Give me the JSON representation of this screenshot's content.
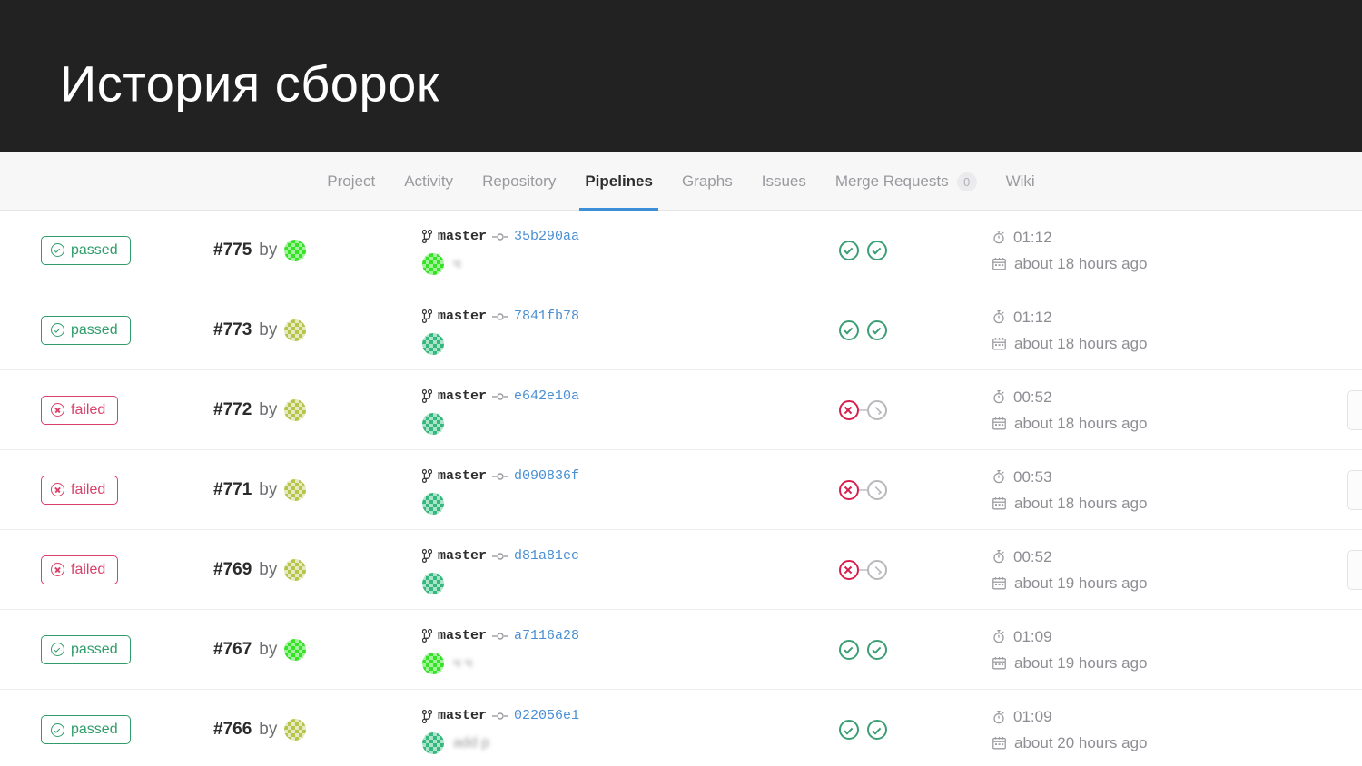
{
  "slide": {
    "title": "История сборок",
    "header_bg": "#222222"
  },
  "nav": {
    "items": [
      {
        "label": "Project",
        "active": false,
        "badge": null
      },
      {
        "label": "Activity",
        "active": false,
        "badge": null
      },
      {
        "label": "Repository",
        "active": false,
        "badge": null
      },
      {
        "label": "Pipelines",
        "active": true,
        "badge": null
      },
      {
        "label": "Graphs",
        "active": false,
        "badge": null
      },
      {
        "label": "Issues",
        "active": false,
        "badge": null
      },
      {
        "label": "Merge Requests",
        "active": false,
        "badge": "0"
      },
      {
        "label": "Wiki",
        "active": false,
        "badge": null
      }
    ],
    "active_underline_color": "#3d8ed8"
  },
  "colors": {
    "passed": "#2f9c6a",
    "failed": "#d9416b",
    "stage_ok": "#3c9e74",
    "stage_fail": "#d5204f",
    "stage_skip": "#b8b8bc",
    "sha_link": "#4a8fd4"
  },
  "table": {
    "by_label": "by",
    "rows": [
      {
        "status": "passed",
        "id": "#775",
        "author_avatar": "identicon-green",
        "branch": "master",
        "sha": "35b290aa",
        "commit_message": "ч",
        "commit_avatar": "identicon-green",
        "stages": [
          "ok",
          "ok"
        ],
        "duration": "01:12",
        "finished": "about 18 hours ago",
        "retry": false
      },
      {
        "status": "passed",
        "id": "#773",
        "author_avatar": "identicon-olive",
        "branch": "master",
        "sha": "7841fb78",
        "commit_message": "",
        "commit_avatar": "identicon-teal",
        "stages": [
          "ok",
          "ok"
        ],
        "duration": "01:12",
        "finished": "about 18 hours ago",
        "retry": false
      },
      {
        "status": "failed",
        "id": "#772",
        "author_avatar": "identicon-olive",
        "branch": "master",
        "sha": "e642e10a",
        "commit_message": "",
        "commit_avatar": "identicon-teal",
        "stages": [
          "fail",
          "skip"
        ],
        "duration": "00:52",
        "finished": "about 18 hours ago",
        "retry": true
      },
      {
        "status": "failed",
        "id": "#771",
        "author_avatar": "identicon-olive",
        "branch": "master",
        "sha": "d090836f",
        "commit_message": "",
        "commit_avatar": "identicon-teal",
        "stages": [
          "fail",
          "skip"
        ],
        "duration": "00:53",
        "finished": "about 18 hours ago",
        "retry": true
      },
      {
        "status": "failed",
        "id": "#769",
        "author_avatar": "identicon-olive",
        "branch": "master",
        "sha": "d81a81ec",
        "commit_message": "",
        "commit_avatar": "identicon-teal",
        "stages": [
          "fail",
          "skip"
        ],
        "duration": "00:52",
        "finished": "about 19 hours ago",
        "retry": true
      },
      {
        "status": "passed",
        "id": "#767",
        "author_avatar": "identicon-green",
        "branch": "master",
        "sha": "a7116a28",
        "commit_message": "ч ч",
        "commit_avatar": "identicon-green",
        "stages": [
          "ok",
          "ok"
        ],
        "duration": "01:09",
        "finished": "about 19 hours ago",
        "retry": false
      },
      {
        "status": "passed",
        "id": "#766",
        "author_avatar": "identicon-olive",
        "branch": "master",
        "sha": "022056e1",
        "commit_message": "add p",
        "commit_avatar": "identicon-teal",
        "stages": [
          "ok",
          "ok"
        ],
        "duration": "01:09",
        "finished": "about 20 hours ago",
        "retry": false
      }
    ]
  }
}
